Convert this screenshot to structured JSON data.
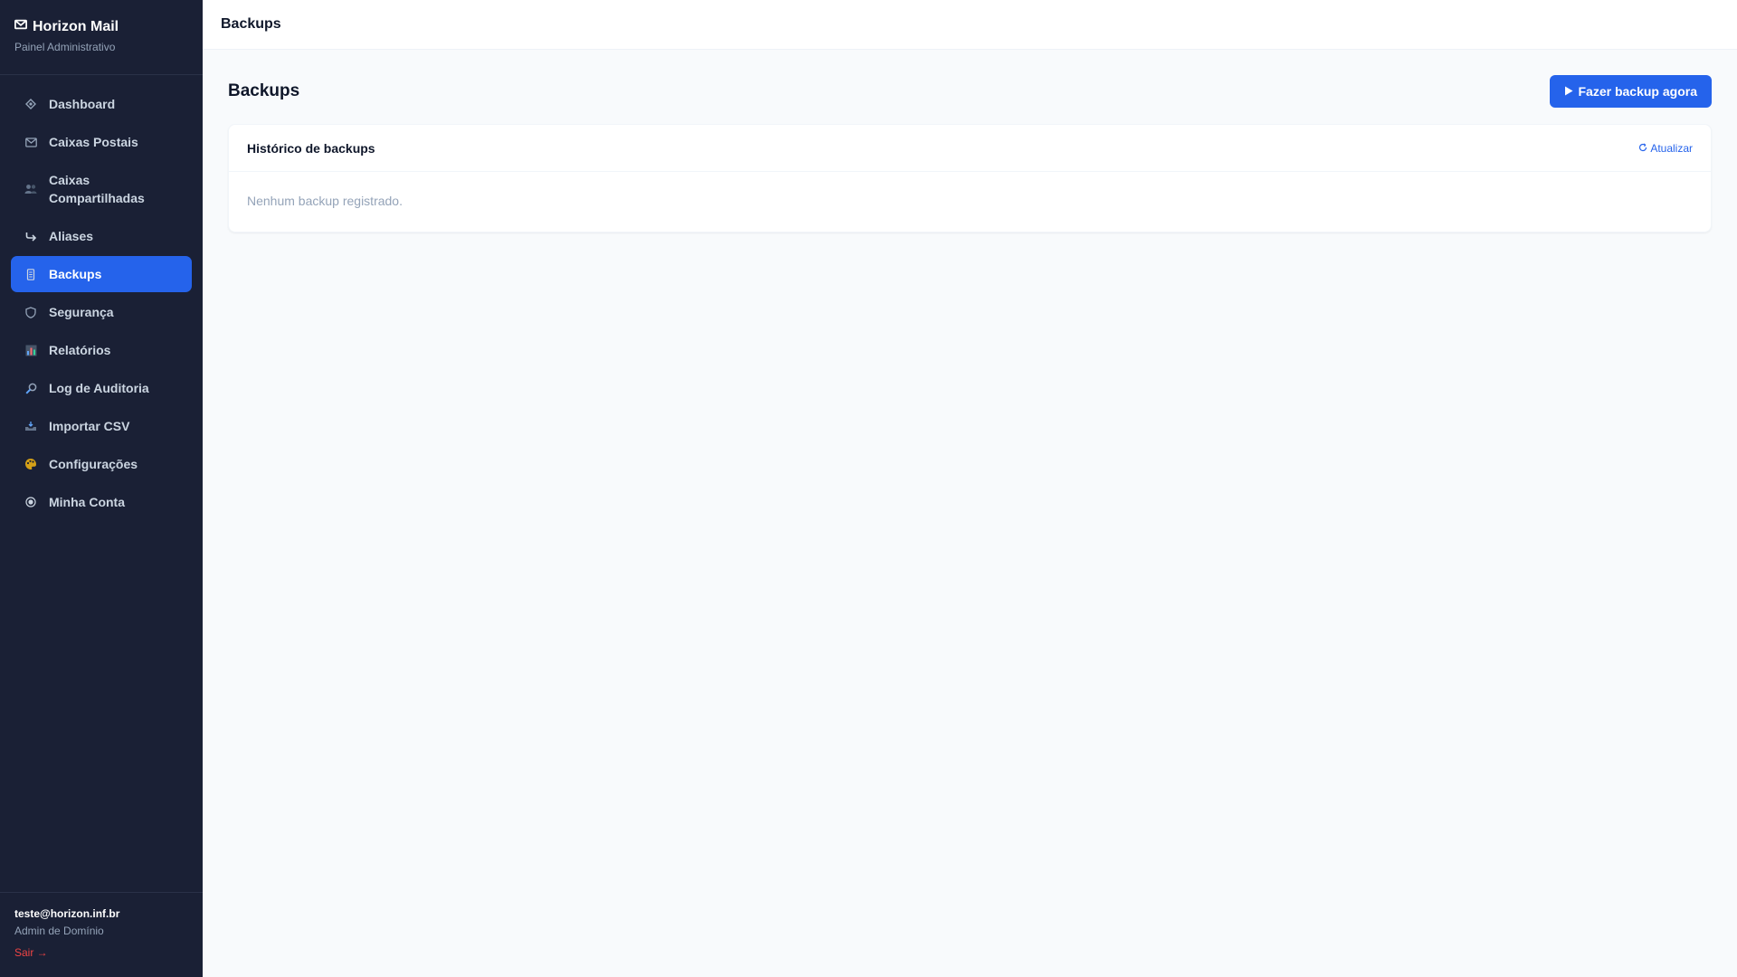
{
  "brand": {
    "title": "Horizon Mail",
    "subtitle": "Painel Administrativo",
    "icon": "mail-icon"
  },
  "sidebar": {
    "items": [
      {
        "label": "Dashboard",
        "icon": "diamond-icon",
        "active": false
      },
      {
        "label": "Caixas Postais",
        "icon": "envelope-icon",
        "active": false
      },
      {
        "label": "Caixas Compartilhadas",
        "icon": "users-icon",
        "active": false
      },
      {
        "label": "Aliases",
        "icon": "forward-arrow-icon",
        "active": false
      },
      {
        "label": "Backups",
        "icon": "storage-icon",
        "active": true
      },
      {
        "label": "Segurança",
        "icon": "shield-icon",
        "active": false
      },
      {
        "label": "Relatórios",
        "icon": "bar-chart-icon",
        "active": false
      },
      {
        "label": "Log de Auditoria",
        "icon": "magnifier-icon",
        "active": false
      },
      {
        "label": "Importar CSV",
        "icon": "tray-icon",
        "active": false
      },
      {
        "label": "Configurações",
        "icon": "palette-icon",
        "active": false
      },
      {
        "label": "Minha Conta",
        "icon": "user-circle-icon",
        "active": false
      }
    ]
  },
  "user": {
    "email": "teste@horizon.inf.br",
    "role": "Admin de Domínio",
    "logout": "Sair →"
  },
  "topbar": {
    "title": "Backups"
  },
  "page": {
    "title": "Backups",
    "action_label": "Fazer backup agora",
    "action_icon": "play-icon"
  },
  "card": {
    "title": "Histórico de backups",
    "refresh_label": "Atualizar",
    "refresh_icon": "refresh-icon",
    "empty_text": "Nenhum backup registrado."
  },
  "colors": {
    "sidebar_bg": "#1a2035",
    "accent": "#2563eb",
    "logout": "#ef4444",
    "page_bg": "#f8fafc"
  }
}
